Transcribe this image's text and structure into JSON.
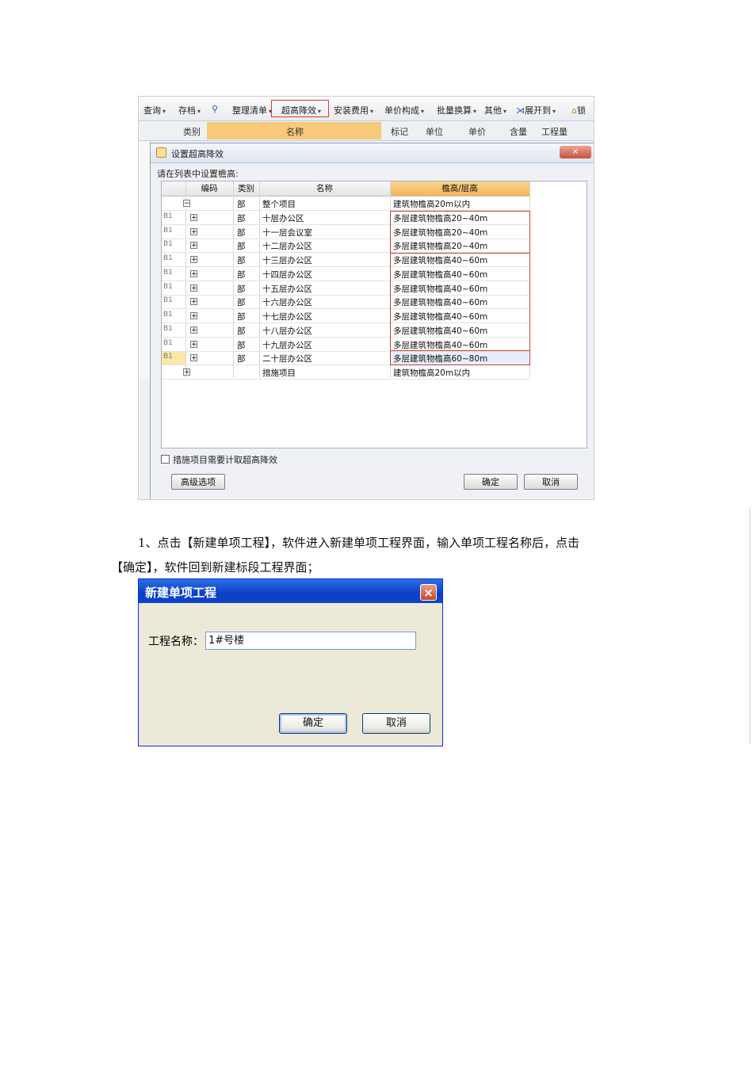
{
  "screenshot1": {
    "toolbar": {
      "items": [
        "查询",
        "存档",
        "整理清单",
        "超高降效",
        "安装费用",
        "单价构成",
        "批量换算",
        "其他",
        "展开到",
        "锁"
      ]
    },
    "background_header": [
      "类别",
      "名称",
      "标记",
      "单位",
      "单价",
      "含量",
      "工程量"
    ],
    "background_row_fragment": "整个项目",
    "dialog": {
      "title": "设置超高降效",
      "close_label": "×",
      "instruction": "请在列表中设置檐高:",
      "columns": [
        "编码",
        "类别",
        "名称",
        "檐高/层高"
      ],
      "rows": [
        {
          "code": "",
          "toggle": "−",
          "category": "部",
          "name": "整个项目",
          "height": "建筑物檐高20m以内"
        },
        {
          "code": "B1",
          "toggle": "+",
          "category": "部",
          "name": "十层办公区",
          "height": "多层建筑物檐高20~40m"
        },
        {
          "code": "B1",
          "toggle": "+",
          "category": "部",
          "name": "十一层会议室",
          "height": "多层建筑物檐高20~40m"
        },
        {
          "code": "B1",
          "toggle": "+",
          "category": "部",
          "name": "十二层办公区",
          "height": "多层建筑物檐高20~40m"
        },
        {
          "code": "B1",
          "toggle": "+",
          "category": "部",
          "name": "十三层办公区",
          "height": "多层建筑物檐高40~60m"
        },
        {
          "code": "B1",
          "toggle": "+",
          "category": "部",
          "name": "十四层办公区",
          "height": "多层建筑物檐高40~60m"
        },
        {
          "code": "B1",
          "toggle": "+",
          "category": "部",
          "name": "十五层办公区",
          "height": "多层建筑物檐高40~60m"
        },
        {
          "code": "B1",
          "toggle": "+",
          "category": "部",
          "name": "十六层办公区",
          "height": "多层建筑物檐高40~60m"
        },
        {
          "code": "B1",
          "toggle": "+",
          "category": "部",
          "name": "十七层办公区",
          "height": "多层建筑物檐高40~60m"
        },
        {
          "code": "B1",
          "toggle": "+",
          "category": "部",
          "name": "十八层办公区",
          "height": "多层建筑物檐高40~60m"
        },
        {
          "code": "B1",
          "toggle": "+",
          "category": "部",
          "name": "十九层办公区",
          "height": "多层建筑物檐高40~60m"
        },
        {
          "code": "B1",
          "toggle": "+",
          "category": "部",
          "name": "二十层办公区",
          "height": "多层建筑物檐高60~80m"
        },
        {
          "code": "",
          "toggle": "+",
          "category": "",
          "name": "措施项目",
          "height": "建筑物檐高20m以内"
        }
      ],
      "checkbox_label": "措施项目需要计取超高降效",
      "advanced_button": "高级选项",
      "ok_button": "确定",
      "cancel_button": "取消"
    }
  },
  "paragraph": {
    "line1": "1、点击【新建单项工程】，软件进入新建单项工程界面，输入单项工程名称后，点击",
    "line2": "【确定】，软件回到新建标段工程界面；"
  },
  "screenshot2": {
    "title": "新建单项工程",
    "close_label": "×",
    "field_label": "工程名称：",
    "field_value": "1#号楼",
    "ok_button": "确定",
    "cancel_button": "取消"
  },
  "colors": {
    "highlight_red": "#c9413f",
    "grid_header_orange": "#f6c97b",
    "xp_title_blue": "#0a3fc8"
  }
}
